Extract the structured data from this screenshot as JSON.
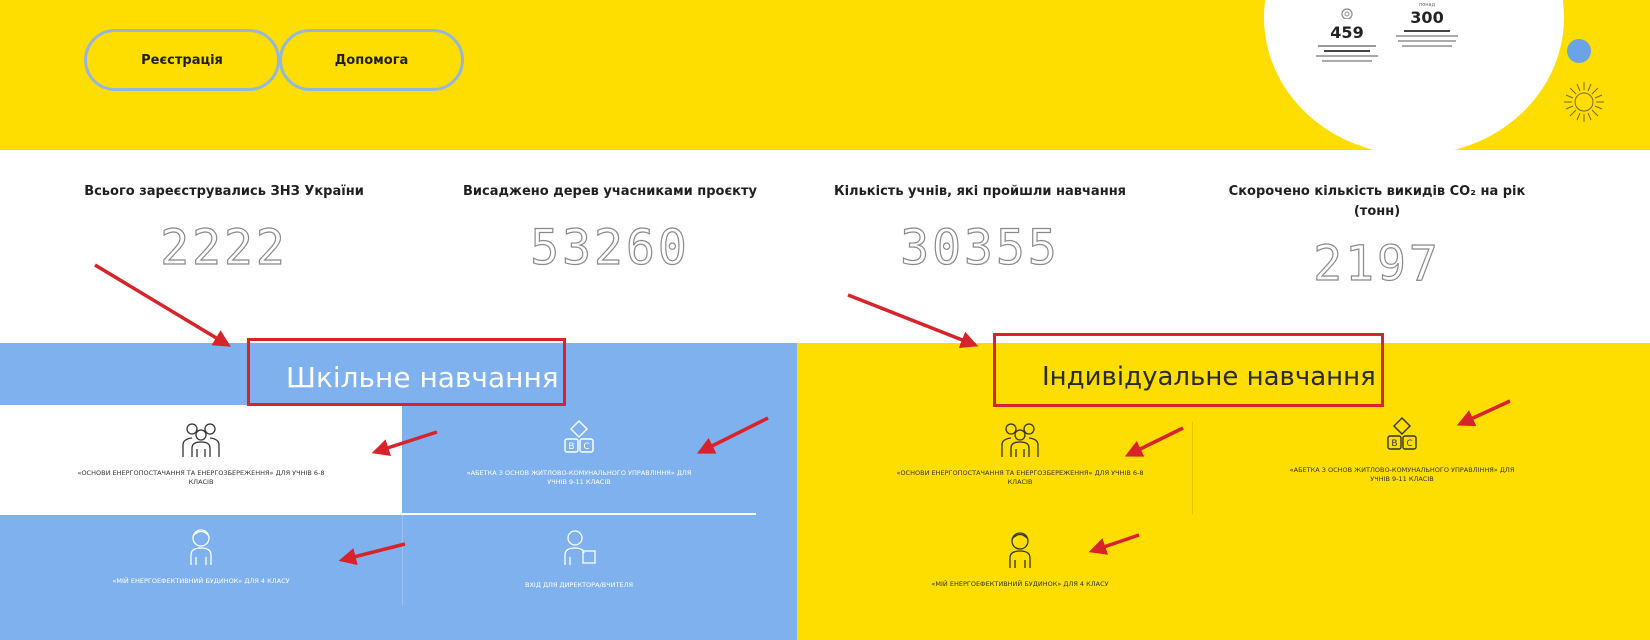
{
  "header": {
    "register_label": "Реєстрація",
    "help_label": "Допомога",
    "badge": {
      "stat1_value": "459",
      "stat2_top": "понад",
      "stat2_value": "300"
    }
  },
  "stats": [
    {
      "label": "Всього зареєструвались ЗНЗ України",
      "value": "2222"
    },
    {
      "label": "Висаджено дерев учасниками проєкту",
      "value": "53260"
    },
    {
      "label": "Кількість учнів, які пройшли навчання",
      "value": "30355"
    },
    {
      "label": "Скорочено кількість викидів CO₂ на рік (тонн)",
      "value": "2197"
    }
  ],
  "school": {
    "title": "Шкільне навчання",
    "items": [
      {
        "text": "«Основи енергопостачання та енергозбереження» для учнів 6-8 класів",
        "icon": "students-group-icon"
      },
      {
        "text": "«Абетка з основ житлово-комунального управління» для учнів 9-11 класів",
        "icon": "abc-blocks-icon"
      },
      {
        "text": "«Мій енергоефективний будинок» для 4 класу",
        "icon": "child-icon"
      },
      {
        "text": "Вхід для директора/вчителя",
        "icon": "teacher-icon"
      }
    ]
  },
  "individual": {
    "title": "Індивідуальне навчання",
    "items": [
      {
        "text": "«Основи енергопостачання та енергозбереження» для учнів 6-8 класів",
        "icon": "students-group-icon"
      },
      {
        "text": "«Абетка з основ житлово-комунального управління» для учнів 9-11 класів",
        "icon": "abc-blocks-icon"
      },
      {
        "text": "«Мій енергоефективний будинок» для 4 класу",
        "icon": "child-icon"
      }
    ]
  },
  "colors": {
    "brand_yellow": "#fedd00",
    "brand_blue": "#80b1ef",
    "annotation_red": "#d8232a"
  }
}
